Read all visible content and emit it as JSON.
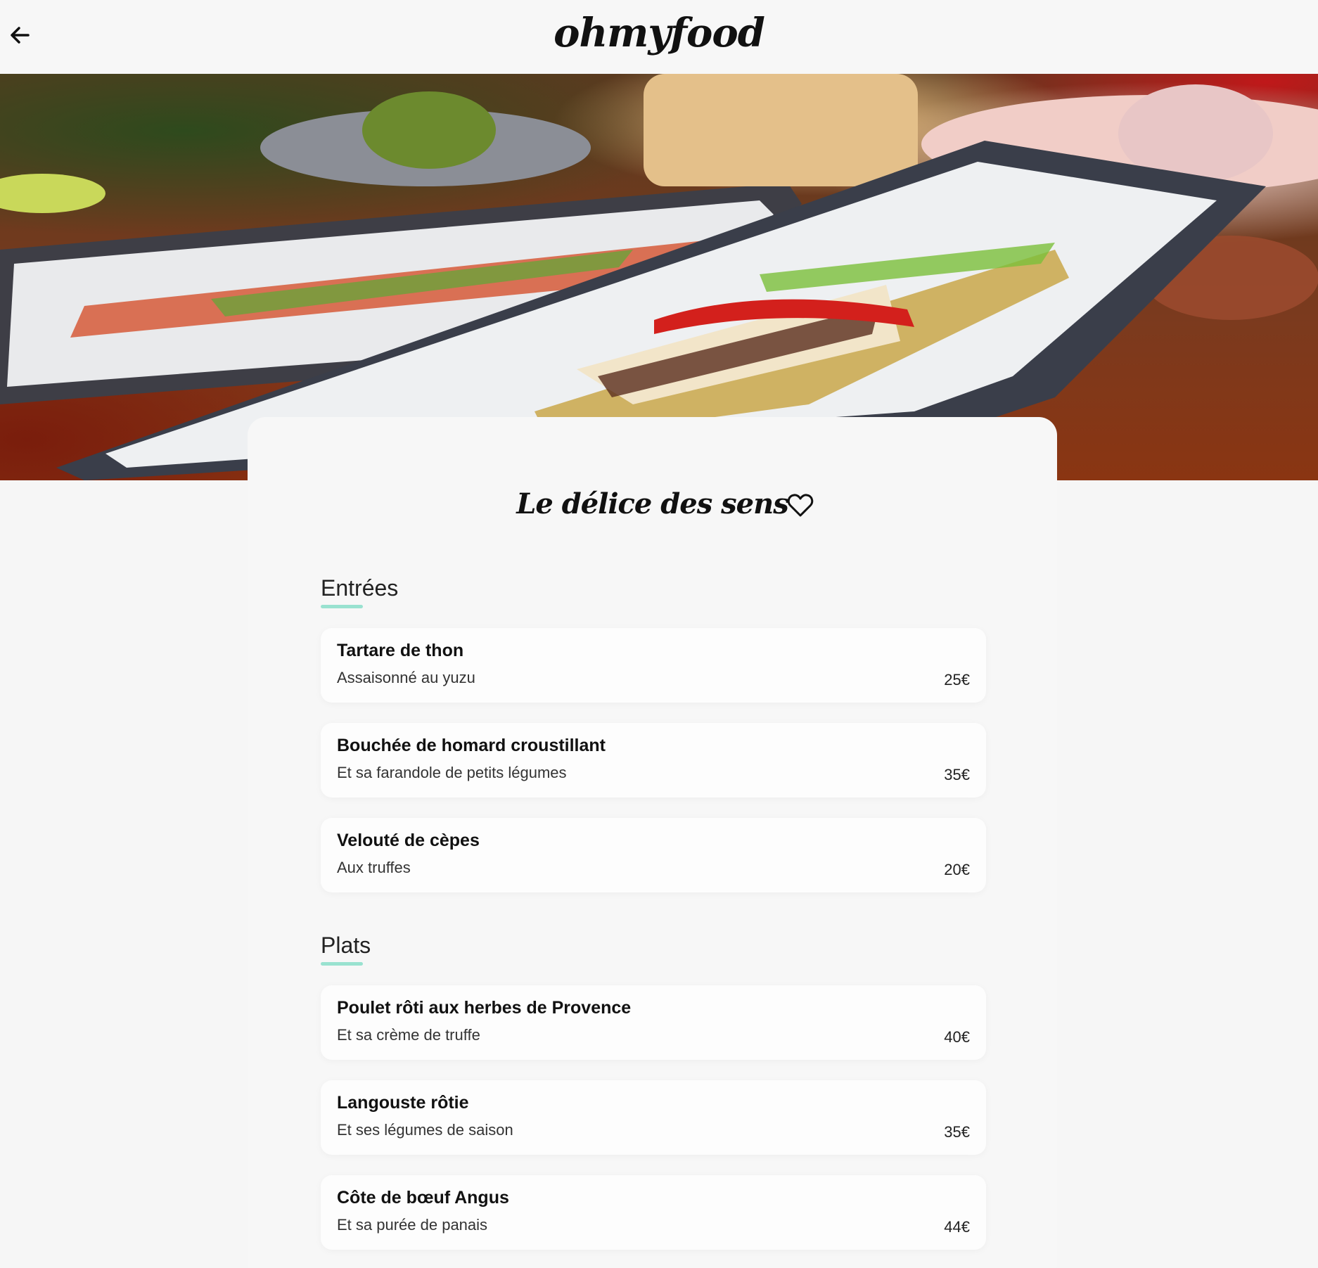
{
  "header": {
    "back_icon": "arrow-left-icon",
    "logo": "ohmyfood"
  },
  "hero": {
    "image_alt": "restaurant dish photo"
  },
  "restaurant": {
    "title": "Le délice des sens",
    "favorite_icon": "heart-outline-icon"
  },
  "colors": {
    "accent": "#99e2d0",
    "card_bg": "#f7f7f7",
    "dish_bg": "#fdfdfd"
  },
  "menu": {
    "sections": [
      {
        "title": "Entrées",
        "dishes": [
          {
            "name": "Tartare de thon",
            "description": "Assaisonné au yuzu",
            "price": "25€"
          },
          {
            "name": "Bouchée de homard croustillant",
            "description": "Et sa farandole de petits légumes",
            "price": "35€"
          },
          {
            "name": "Velouté de cèpes",
            "description": "Aux truffes",
            "price": "20€"
          }
        ]
      },
      {
        "title": "Plats",
        "dishes": [
          {
            "name": "Poulet rôti aux herbes de Provence",
            "description": "Et sa crème de truffe",
            "price": "40€"
          },
          {
            "name": "Langouste rôtie",
            "description": "Et ses légumes de saison",
            "price": "35€"
          },
          {
            "name": "Côte de bœuf Angus",
            "description": "Et sa purée de panais",
            "price": "44€"
          }
        ]
      }
    ]
  }
}
